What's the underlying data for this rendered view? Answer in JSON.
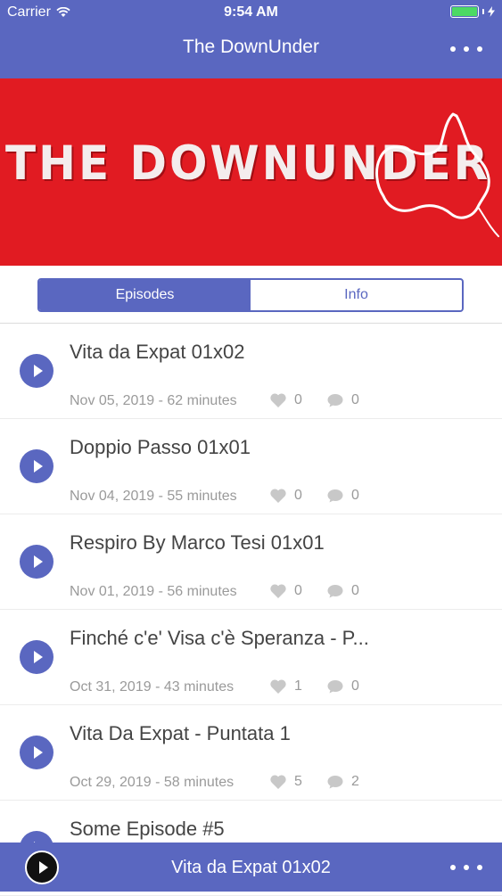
{
  "status_bar": {
    "carrier": "Carrier",
    "time": "9:54 AM",
    "battery_color": "#4cd964"
  },
  "nav": {
    "title": "The DownUnder",
    "more_icon": "more-horizontal-icon"
  },
  "banner": {
    "text": "THE DOWNUNDER",
    "background": "#e11b22"
  },
  "tabs": [
    {
      "label": "Episodes",
      "selected": true
    },
    {
      "label": "Info",
      "selected": false
    }
  ],
  "episodes": [
    {
      "title": "Vita da Expat 01x02",
      "meta": "Nov 05, 2019 - 62 minutes",
      "likes": "0",
      "comments": "0"
    },
    {
      "title": "Doppio Passo 01x01",
      "meta": "Nov 04, 2019 - 55 minutes",
      "likes": "0",
      "comments": "0"
    },
    {
      "title": "Respiro By Marco Tesi 01x01",
      "meta": "Nov 01, 2019 - 56 minutes",
      "likes": "0",
      "comments": "0"
    },
    {
      "title": "Finché c'e' Visa c'è Speranza - P...",
      "meta": "Oct 31, 2019 - 43 minutes",
      "likes": "1",
      "comments": "0"
    },
    {
      "title": "Vita Da Expat - Puntata 1",
      "meta": "Oct 29, 2019 - 58 minutes",
      "likes": "5",
      "comments": "2"
    },
    {
      "title": "Some Episode #5",
      "meta": "",
      "likes": "",
      "comments": ""
    }
  ],
  "player": {
    "now_playing": "Vita da Expat 01x02",
    "play_icon": "play-icon"
  },
  "colors": {
    "accent": "#5a67c0",
    "meta_text": "#9a9a9a"
  }
}
